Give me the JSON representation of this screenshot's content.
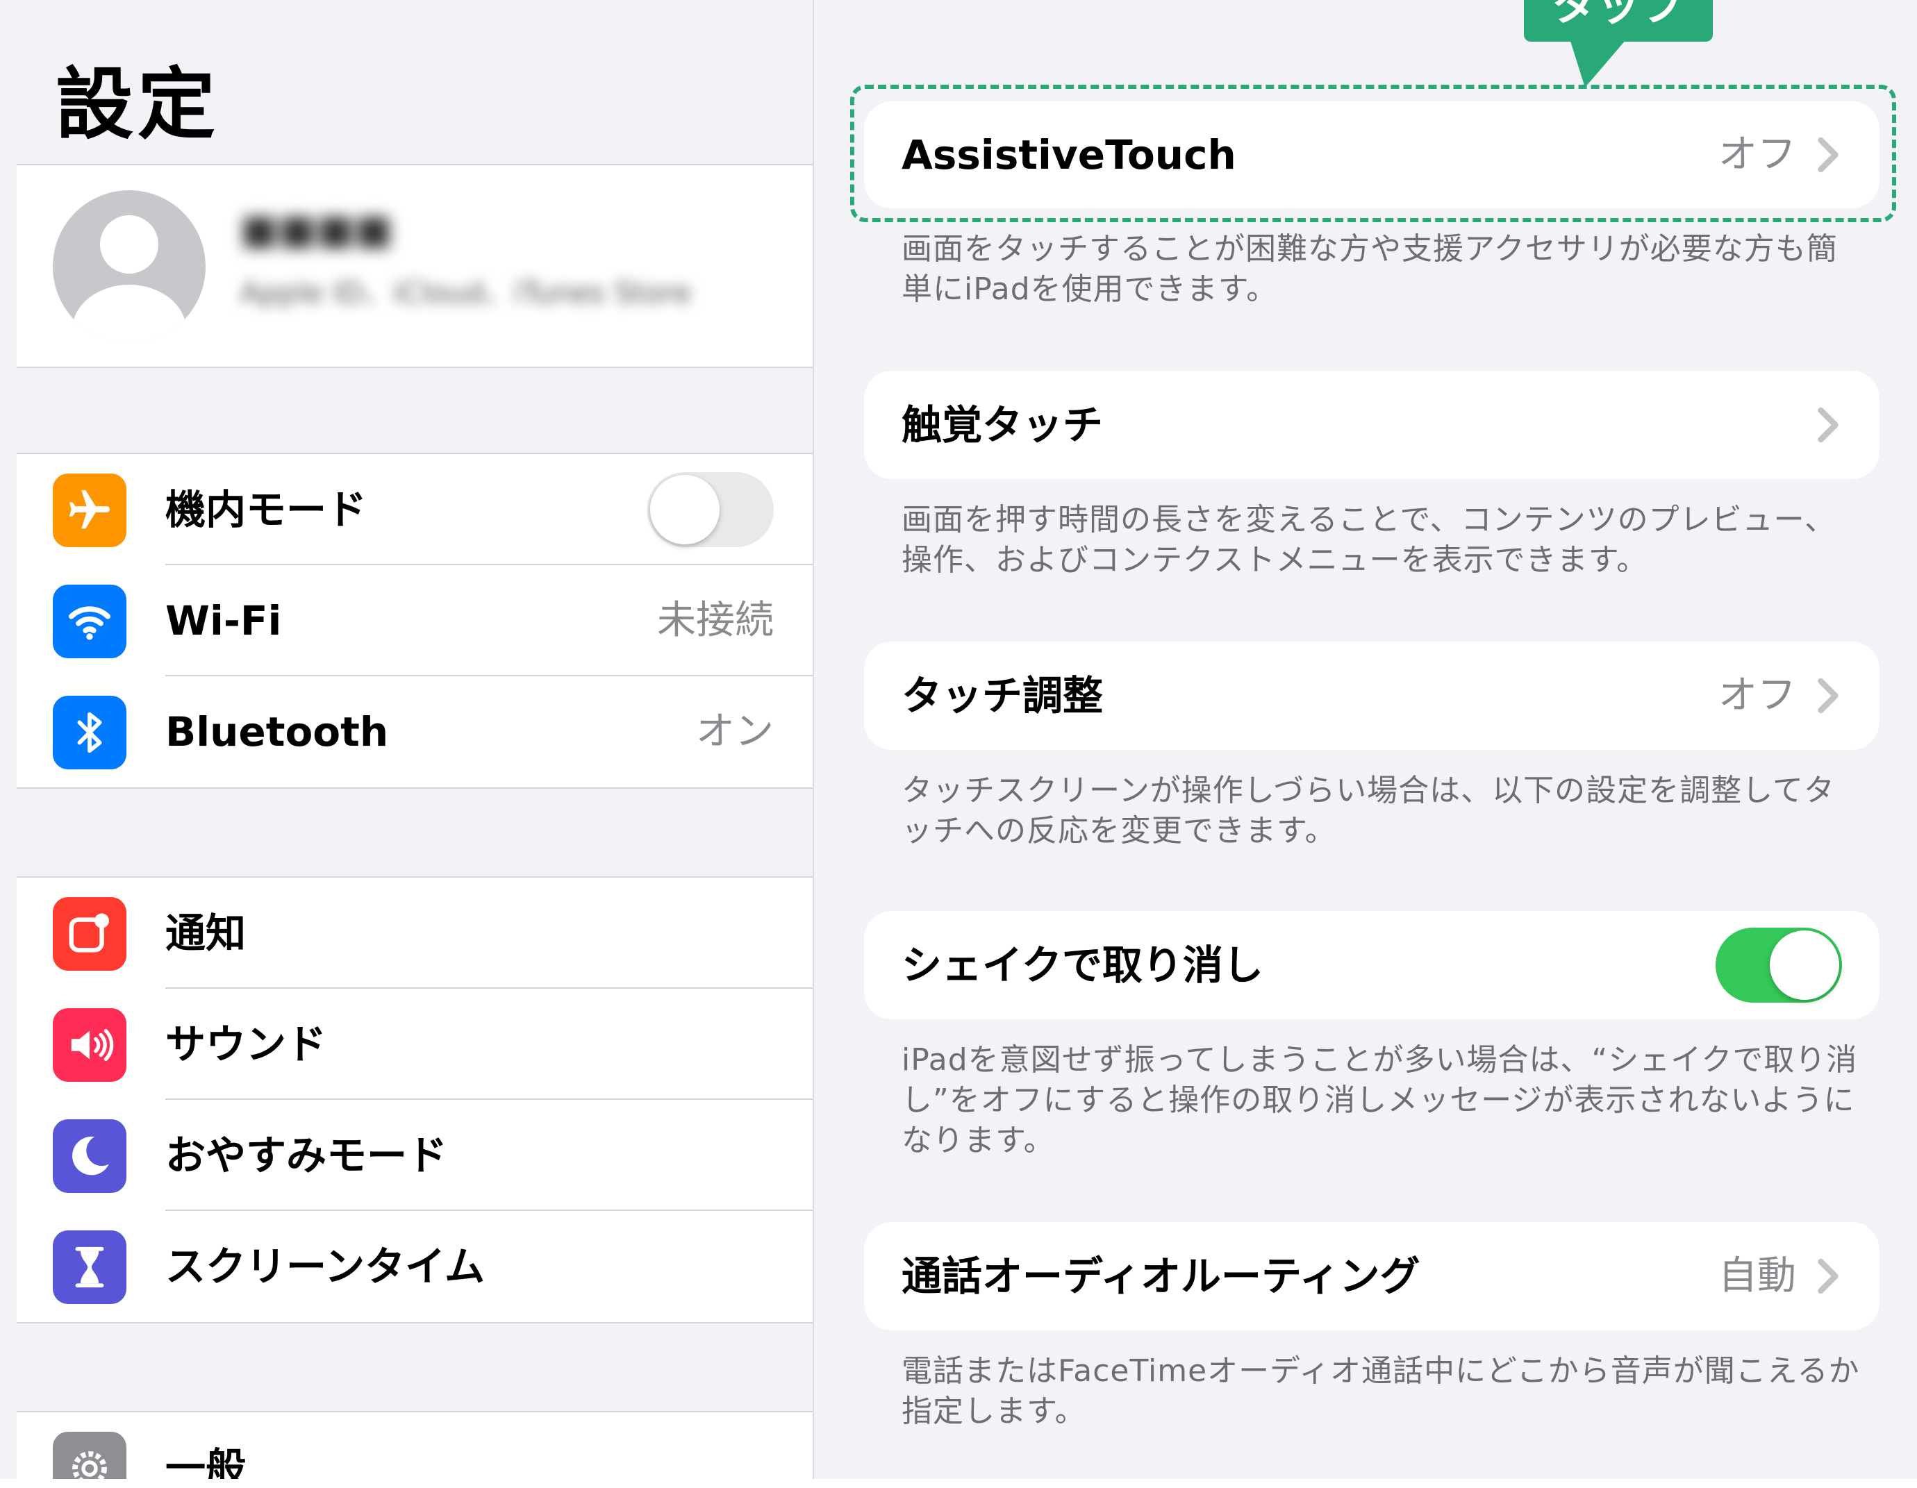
{
  "sidebar": {
    "title": "設定",
    "profile": {
      "name": "■■■■",
      "subtitle": "Apple ID、iCloud、iTunes Store"
    },
    "group1": [
      {
        "label": "機内モード",
        "icon": "airplane-icon",
        "color": "#ff9500",
        "toggle": false
      },
      {
        "label": "Wi-Fi",
        "icon": "wifi-icon",
        "color": "#007aff",
        "value": "未接続"
      },
      {
        "label": "Bluetooth",
        "icon": "bluetooth-icon",
        "color": "#007aff",
        "value": "オン"
      }
    ],
    "group2": [
      {
        "label": "通知",
        "icon": "notification-icon",
        "color": "#ff3b30"
      },
      {
        "label": "サウンド",
        "icon": "speaker-icon",
        "color": "#ff2d55"
      },
      {
        "label": "おやすみモード",
        "icon": "moon-icon",
        "color": "#5856d6"
      },
      {
        "label": "スクリーンタイム",
        "icon": "hourglass-icon",
        "color": "#5856d6"
      }
    ],
    "group3": [
      {
        "label": "一般",
        "icon": "gear-icon",
        "color": "#8e8e93"
      }
    ]
  },
  "detail": {
    "callout": "タップ",
    "assistive_touch": {
      "label": "AssistiveTouch",
      "value": "オフ",
      "description": "画面をタッチすることが困難な方や支援アクセサリが必要な方も簡単にiPadを使用できます。"
    },
    "haptic_touch": {
      "label": "触覚タッチ",
      "description": "画面を押す時間の長さを変えることで、コンテンツのプレビュー、操作、およびコンテクストメニューを表示できます。"
    },
    "touch_accommodations": {
      "label": "タッチ調整",
      "value": "オフ",
      "description": "タッチスクリーンが操作しづらい場合は、以下の設定を調整してタッチへの反応を変更できます。"
    },
    "shake_to_undo": {
      "label": "シェイクで取り消し",
      "toggle": true,
      "description": "iPadを意図せず振ってしまうことが多い場合は、“シェイクで取り消し”をオフにすると操作の取り消しメッセージが表示されないようになります。"
    },
    "call_audio_routing": {
      "label": "通話オーディオルーティング",
      "value": "自動",
      "description": "電話またはFaceTimeオーディオ通話中にどこから音声が聞こえるか指定します。"
    }
  },
  "colors": {
    "accent_green": "#2aa978",
    "toggle_on": "#34c759",
    "secondary_text": "#8a8a8e"
  }
}
